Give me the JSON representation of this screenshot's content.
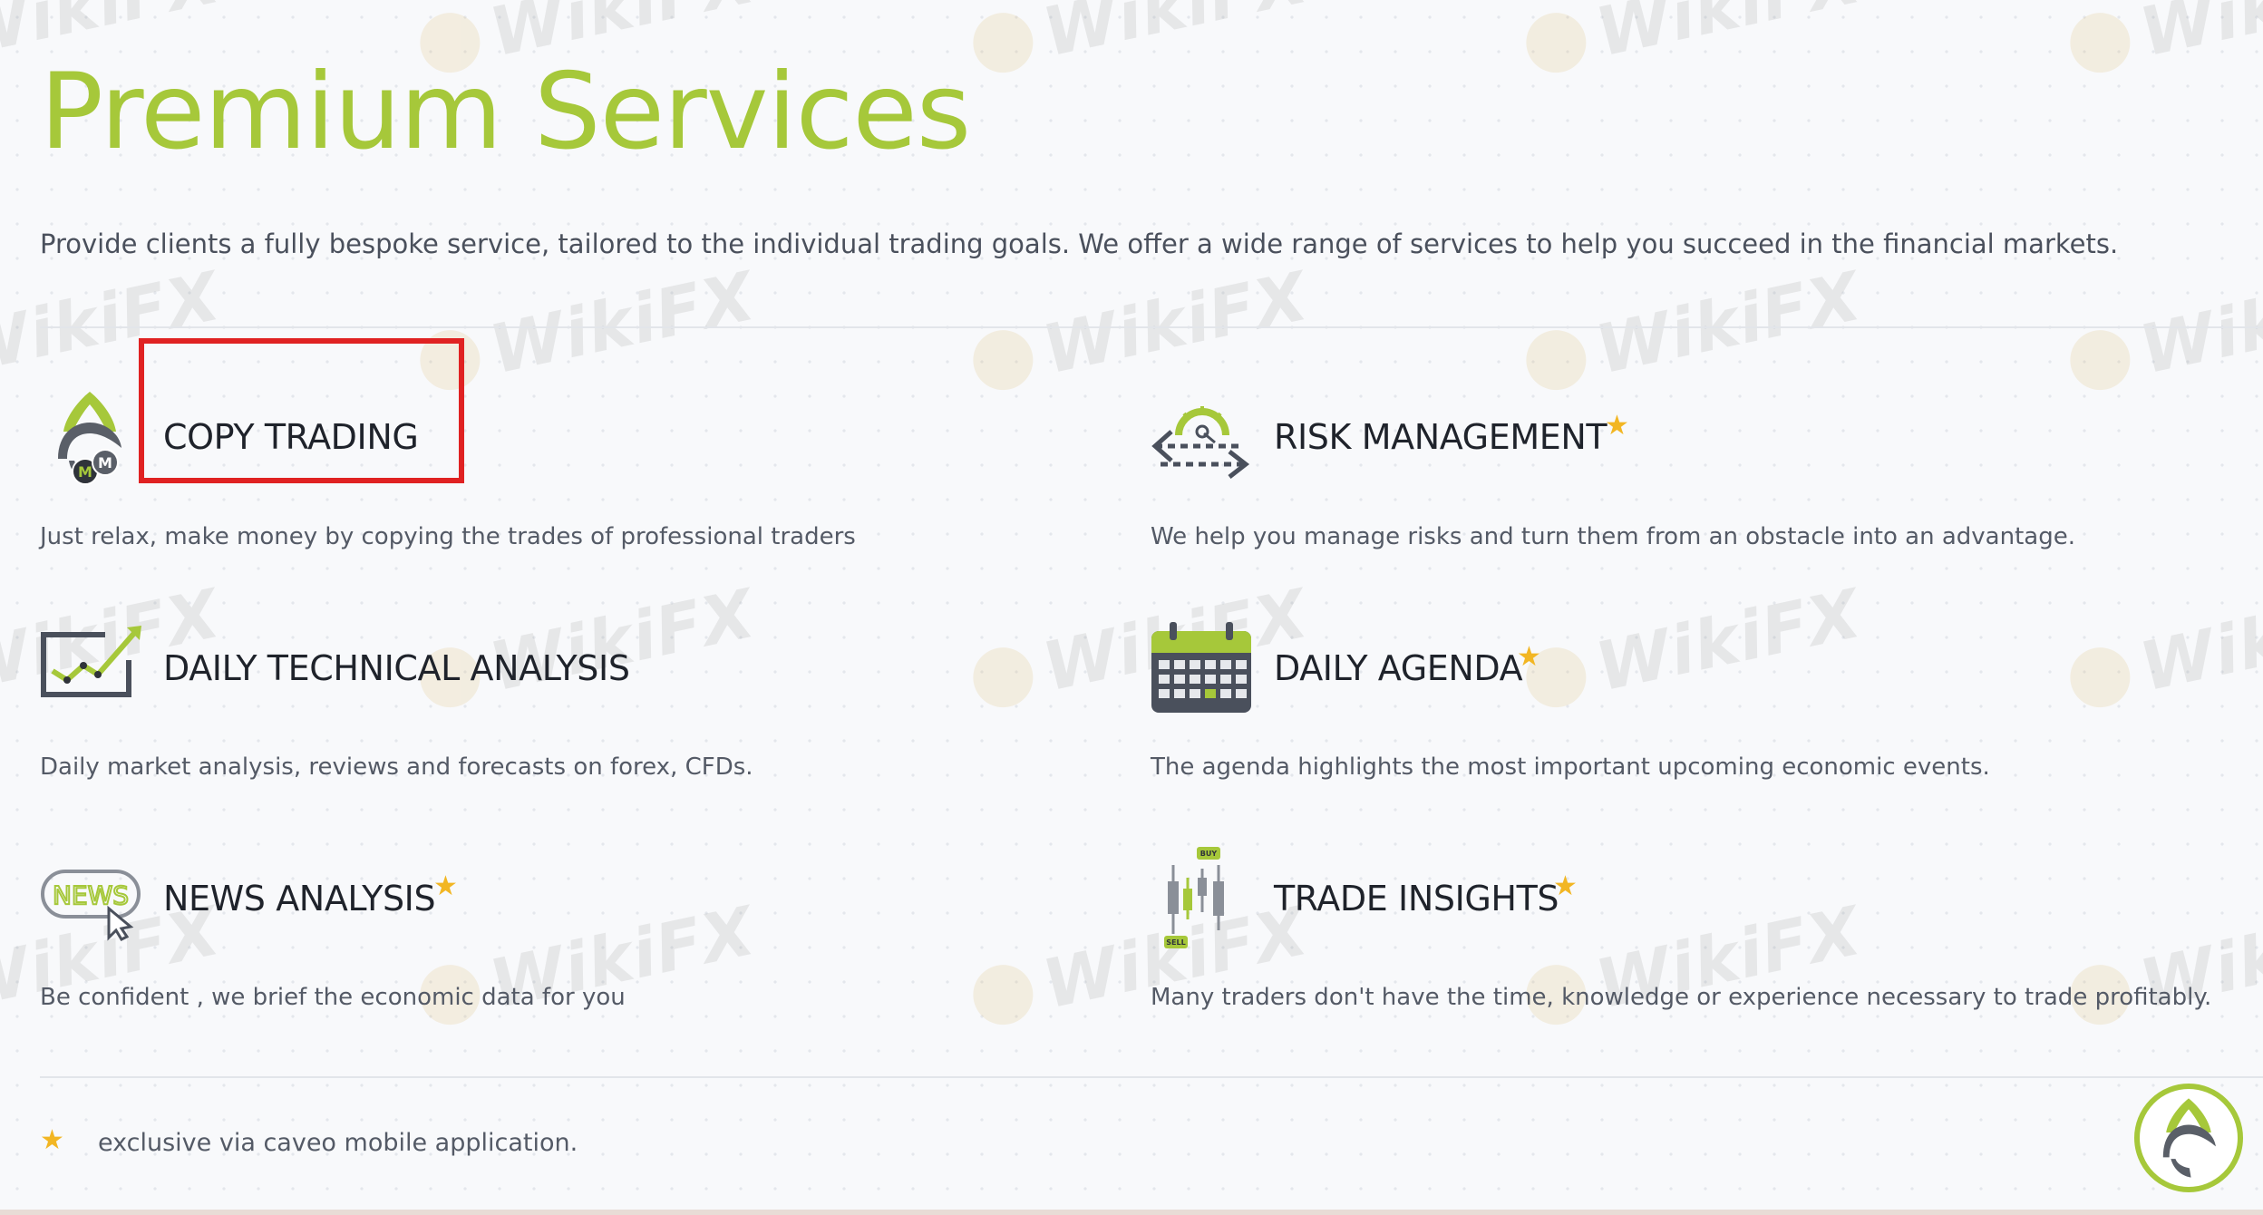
{
  "header": {
    "title": "Premium Services",
    "intro": "Provide clients a fully bespoke service, tailored to the individual trading goals. We offer a wide range of services to help you succeed in the financial markets."
  },
  "services": [
    {
      "title": "COPY TRADING",
      "description": "Just relax, make money by copying the trades of professional traders",
      "icon": "copy-trading-icon",
      "exclusive": false,
      "highlighted": true
    },
    {
      "title": "RISK MANAGEMENT",
      "description": "We help you manage risks and turn them from an obstacle into an advantage.",
      "icon": "risk-gauge-icon",
      "exclusive": true
    },
    {
      "title": "DAILY TECHNICAL ANALYSIS",
      "description": "Daily market analysis, reviews and forecasts on forex, CFDs.",
      "icon": "trend-chart-icon",
      "exclusive": false
    },
    {
      "title": "DAILY AGENDA",
      "description": "The agenda highlights the most important upcoming economic events.",
      "icon": "calendar-icon",
      "exclusive": true
    },
    {
      "title": "NEWS ANALYSIS",
      "description": "Be confident , we brief the economic data for you",
      "icon": "news-icon",
      "icon_label": "NEWS",
      "exclusive": true
    },
    {
      "title": "TRADE INSIGHTS",
      "description": "Many traders don't have the time, knowledge or experience necessary to trade profitably.",
      "icon": "candlestick-icon",
      "icon_labels": {
        "buy": "BUY",
        "sell": "SELL"
      },
      "exclusive": true
    }
  ],
  "footnote": {
    "text": "exclusive via caveo mobile application.",
    "icon": "star-icon"
  },
  "watermark": {
    "text": "WikiFX"
  },
  "chat_button": {
    "icon": "brand-logo-icon"
  },
  "colors": {
    "accent": "#a6c83a",
    "star": "#f2b623",
    "highlight": "#e02222",
    "heading": "#1f232b",
    "text": "#545a66",
    "background": "#f8f9fb"
  }
}
